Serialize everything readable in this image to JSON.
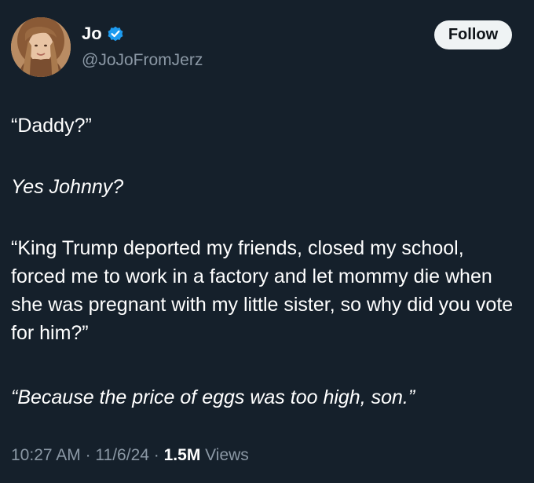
{
  "author": {
    "display_name": "Jo",
    "handle": "@JoJoFromJerz",
    "verified": true,
    "verified_color": "#1d9bf0"
  },
  "follow_label": "Follow",
  "tweet": {
    "paragraphs": [
      "“Daddy?”",
      "Yes Johnny?",
      "“King Trump deported my friends, closed my school, forced me to work in a factory and let mommy die when she was pregnant with my little sister, so why did you vote for him?”",
      "“Because the price of eggs was too high, son.”"
    ]
  },
  "meta": {
    "time": "10:27 AM",
    "date": "11/6/24",
    "separator": "·",
    "views_count": "1.5M",
    "views_label": "Views"
  },
  "colors": {
    "background": "#15202b",
    "text": "#ffffff",
    "secondary_text": "#8b98a5",
    "follow_bg": "#eff3f4"
  }
}
